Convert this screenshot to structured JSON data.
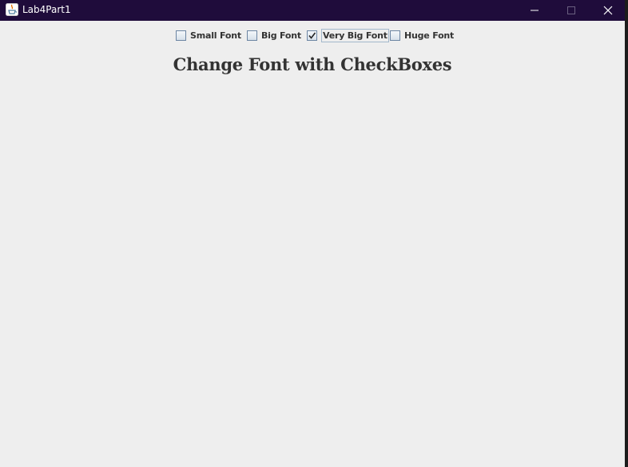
{
  "window": {
    "title": "Lab4Part1",
    "icon": "java-cup-icon",
    "title_bar_color": "#1f0c3b",
    "background_color": "#eeeeee"
  },
  "checkboxes": [
    {
      "label": "Small Font",
      "checked": false
    },
    {
      "label": "Big Font",
      "checked": false
    },
    {
      "label": "Very Big Font",
      "checked": true,
      "focused": true
    },
    {
      "label": "Huge Font",
      "checked": false
    }
  ],
  "heading": {
    "text": "Change Font with CheckBoxes",
    "color": "#333333"
  }
}
